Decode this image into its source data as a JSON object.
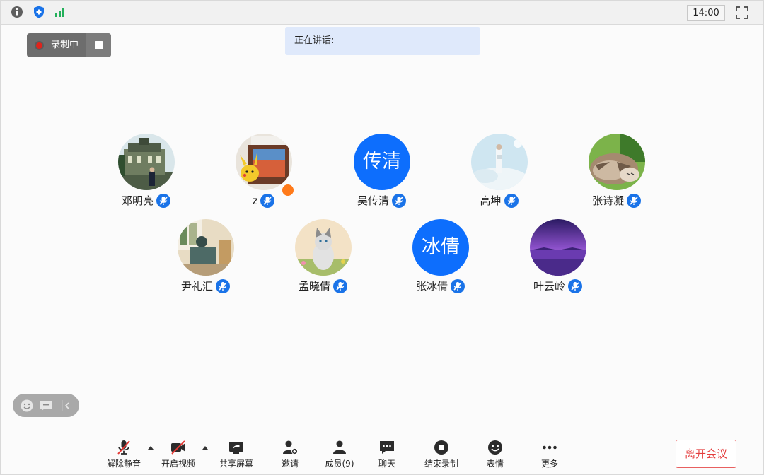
{
  "topbar": {
    "icons": [
      "info-icon",
      "shield-icon",
      "signal-icon",
      "fullscreen-icon"
    ],
    "time": "14:00"
  },
  "recording": {
    "label": "录制中"
  },
  "speaking": {
    "label": "正在讲话:"
  },
  "participants": [
    {
      "name": "邓明亮",
      "avatar": "photo-building"
    },
    {
      "name": "z",
      "avatar": "photo-pikachu",
      "host": true
    },
    {
      "name": "吴传清",
      "avatar_text": "传清"
    },
    {
      "name": "高坤",
      "avatar": "photo-snow"
    },
    {
      "name": "张诗凝",
      "avatar": "photo-cat"
    },
    {
      "name": "尹礼汇",
      "avatar": "photo-room"
    },
    {
      "name": "孟晓倩",
      "avatar": "photo-kitten"
    },
    {
      "name": "张冰倩",
      "avatar_text": "冰倩"
    },
    {
      "name": "叶云岭",
      "avatar": "photo-purple"
    }
  ],
  "toolbar": {
    "unmute": "解除静音",
    "start_video": "开启视频",
    "share_screen": "共享屏幕",
    "invite": "邀请",
    "members": "成员(9)",
    "chat": "聊天",
    "end_recording": "结束录制",
    "emoji": "表情",
    "more": "更多",
    "leave": "离开会议"
  },
  "colors": {
    "accent": "#0d6efd",
    "leave": "#e43e3e",
    "recording": "#e0231b",
    "banner": "#dfe9fb"
  }
}
